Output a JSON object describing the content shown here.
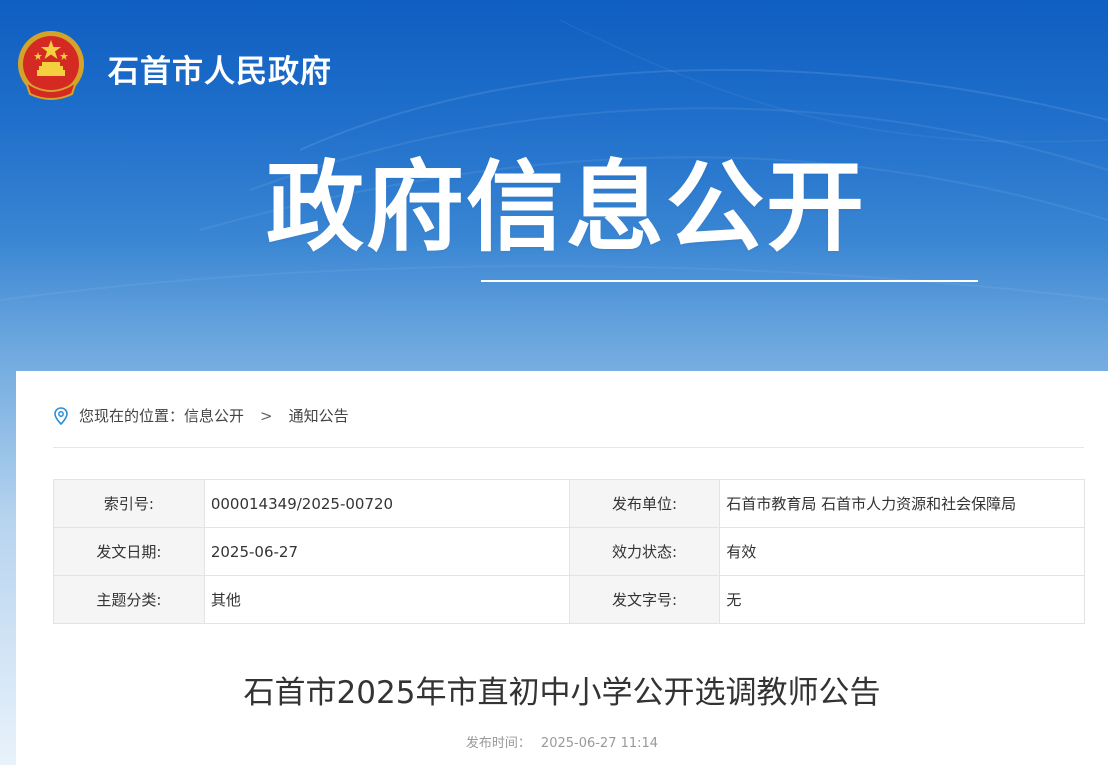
{
  "header": {
    "site_title": "石首市人民政府",
    "banner_heading": "政府信息公开",
    "emblem_icon": "national-emblem-icon"
  },
  "breadcrumb": {
    "prefix": "您现在的位置：",
    "items": [
      "信息公开",
      "通知公告"
    ],
    "separator": ">",
    "icon": "location-pin-icon"
  },
  "meta": {
    "rows": [
      {
        "k1": "索引号:",
        "v1": "000014349/2025-00720",
        "k2": "发布单位:",
        "v2": "石首市教育局 石首市人力资源和社会保障局"
      },
      {
        "k1": "发文日期:",
        "v1": "2025-06-27",
        "k2": "效力状态:",
        "v2": "有效"
      },
      {
        "k1": "主题分类:",
        "v1": "其他",
        "k2": "发文字号:",
        "v2": "无"
      }
    ]
  },
  "article": {
    "title": "石首市2025年市直初中小学公开选调教师公告",
    "publish_label": "发布时间：",
    "publish_time": "2025-06-27 11:14"
  },
  "colors": {
    "banner_top": "#0f5ec1",
    "banner_bottom": "#e9f2fb",
    "accent_icon": "#2a8fd6"
  }
}
